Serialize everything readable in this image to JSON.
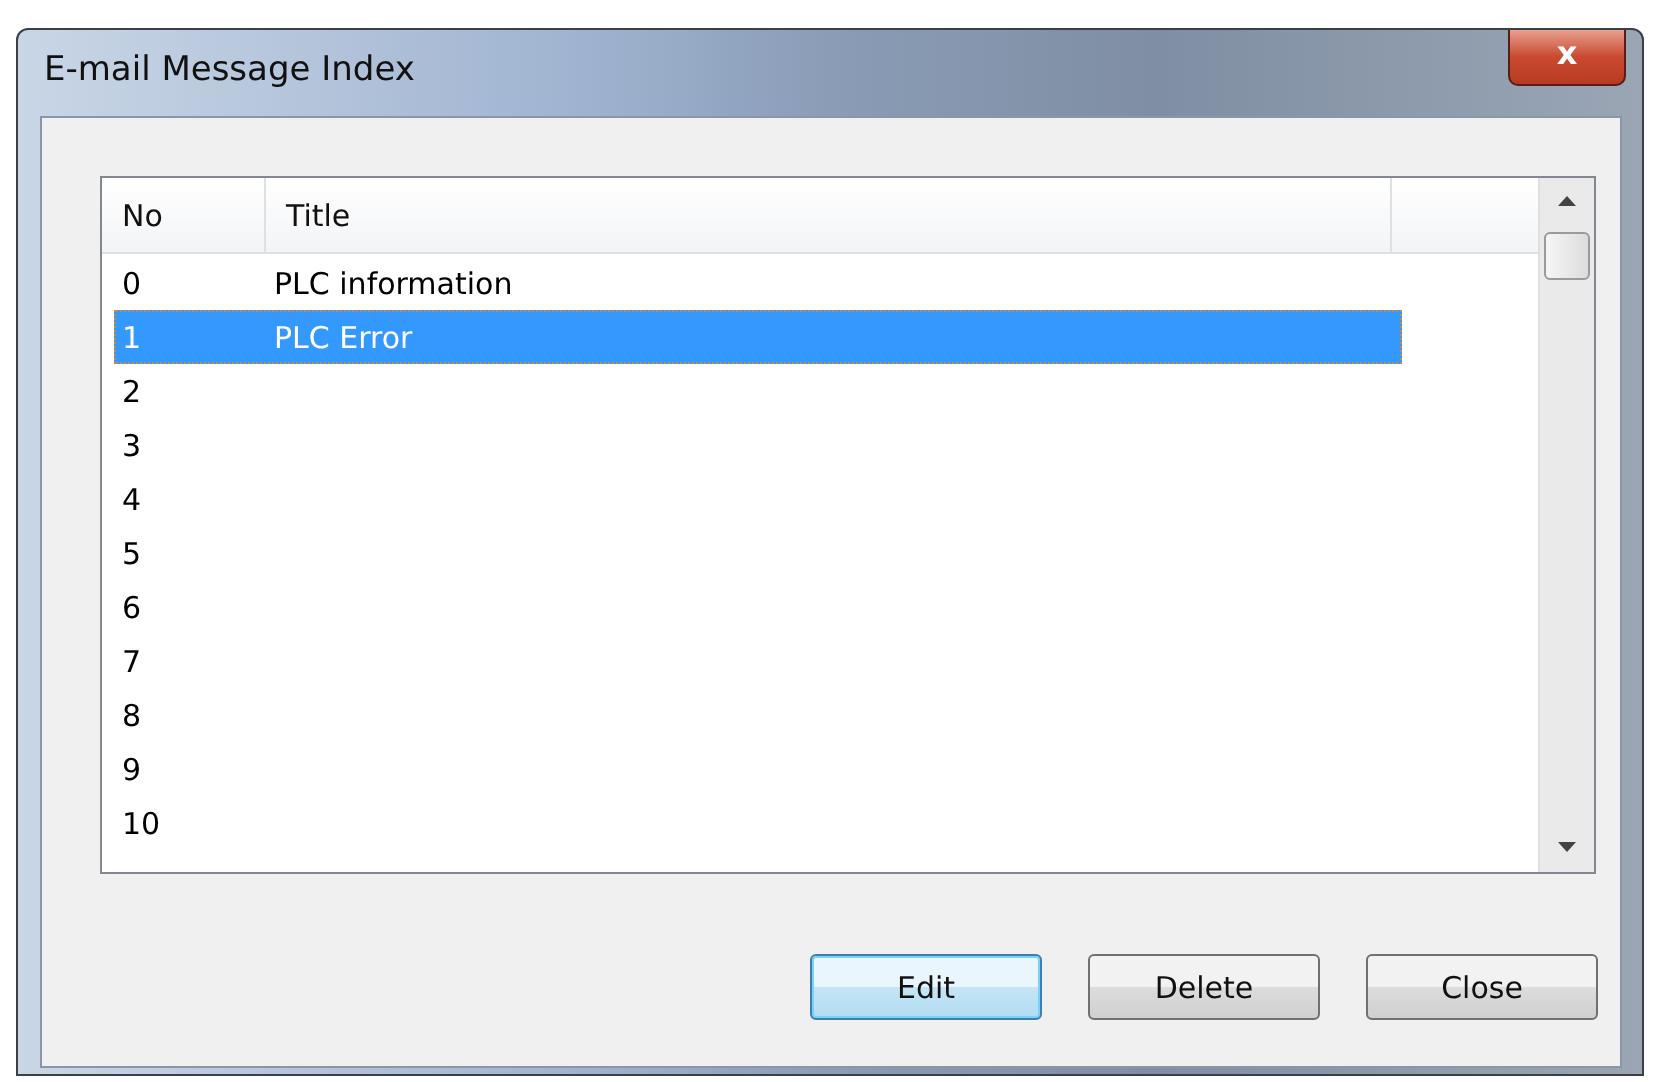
{
  "window": {
    "title": "E-mail Message Index",
    "close_label": "x"
  },
  "table": {
    "columns": [
      "No",
      "Title"
    ],
    "rows": [
      {
        "no": "0",
        "title": "PLC information",
        "selected": false
      },
      {
        "no": "1",
        "title": "PLC Error",
        "selected": true
      },
      {
        "no": "2",
        "selected": false
      },
      {
        "no": "3",
        "selected": false
      },
      {
        "no": "4",
        "selected": false
      },
      {
        "no": "5",
        "selected": false
      },
      {
        "no": "6",
        "selected": false
      },
      {
        "no": "7",
        "selected": false
      },
      {
        "no": "8",
        "selected": false
      },
      {
        "no": "9",
        "selected": false
      },
      {
        "no": "10",
        "selected": false
      }
    ]
  },
  "buttons": [
    {
      "label": "Edit",
      "default": true
    },
    {
      "label": "Delete",
      "default": false
    },
    {
      "label": "Close",
      "default": false
    }
  ]
}
